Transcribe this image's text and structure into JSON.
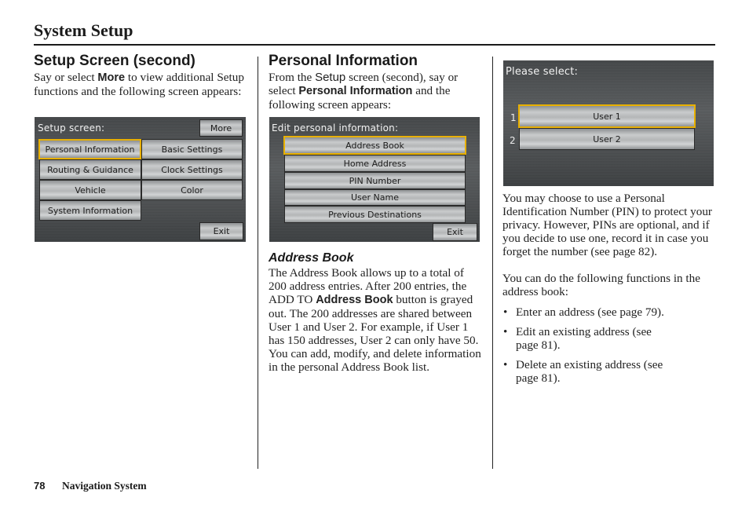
{
  "page": {
    "title": "System Setup",
    "footer": {
      "page_number": "78",
      "section": "Navigation System"
    }
  },
  "col1": {
    "heading": "Setup Screen (second)",
    "intro": {
      "pre": "Say or select ",
      "bold": "More",
      "post": " to view additional Setup functions and the following screen appears:"
    },
    "screen": {
      "label": "Setup screen:",
      "more_button": "More",
      "buttons": [
        "Personal Information",
        "Basic Settings",
        "Routing & Guidance",
        "Clock Settings",
        "Vehicle",
        "Color",
        "System Information"
      ],
      "selected": "Personal Information",
      "exit_button": "Exit"
    }
  },
  "col2": {
    "heading": "Personal Information",
    "intro": {
      "pre": "From the ",
      "sans": "Setup",
      "mid": " screen (second), say or select ",
      "bold": "Personal Information",
      "post": " and the following screen appears:"
    },
    "screen": {
      "label": "Edit personal information:",
      "buttons": [
        "Address Book",
        "Home Address",
        "PIN Number",
        "User Name",
        "Previous Destinations"
      ],
      "selected": "Address Book",
      "exit_button": "Exit"
    },
    "subheading": "Address Book",
    "body": {
      "pre": "The Address Book allows up to a total of 200 address entries. After 200 entries, the ADD TO ",
      "bold": "Address Book",
      "post": " button is grayed out. The 200 addresses are shared between User 1 and User 2. For example, if User 1 has 150 addresses, User 2 can only have 50."
    },
    "body2": "You can add, modify, and delete information in the personal Address Book list."
  },
  "col3": {
    "screen": {
      "label": "Please select:",
      "options": [
        {
          "num": "1",
          "label": "User 1"
        },
        {
          "num": "2",
          "label": "User 2"
        }
      ],
      "selected": "User 1"
    },
    "para1": "You may choose to use a Personal Identification Number (PIN) to protect your privacy. However, PINs are optional, and if you decide to use one, record it in case you forget the number (see page 82).",
    "para2": "You can do the following functions in the address book:",
    "bullets": [
      "Enter an address (see page 79).",
      "Edit an existing address (see page 81).",
      "Delete an existing address (see page 81)."
    ]
  },
  "colors": {
    "highlight": "#e8b000",
    "screen_bg": "#4d5052",
    "text": "#222222"
  }
}
